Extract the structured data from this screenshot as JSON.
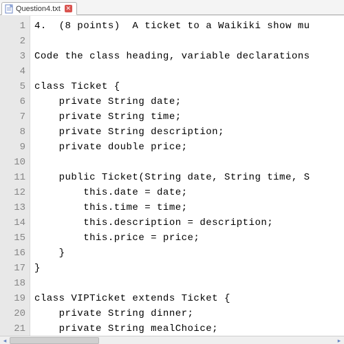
{
  "tab": {
    "filename": "Question4.txt",
    "close_glyph": "✕"
  },
  "scroll": {
    "left_glyph": "◂",
    "right_glyph": "▸"
  },
  "code_lines": [
    "4.  (8 points)  A ticket to a Waikiki show mu",
    "",
    "Code the class heading, variable declarations",
    "",
    "class Ticket {",
    "    private String date;",
    "    private String time;",
    "    private String description;",
    "    private double price;",
    "",
    "    public Ticket(String date, String time, S",
    "        this.date = date;",
    "        this.time = time;",
    "        this.description = description;",
    "        this.price = price;",
    "    }",
    "}",
    "",
    "class VIPTicket extends Ticket {",
    "    private String dinner;",
    "    private String mealChoice;"
  ]
}
